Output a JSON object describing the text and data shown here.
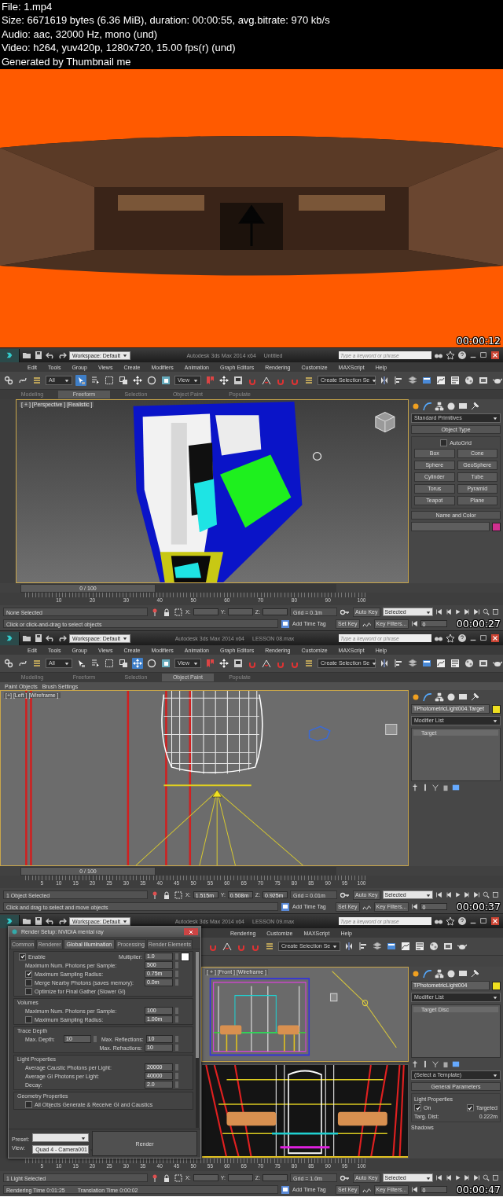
{
  "header": {
    "lines": [
      "File: 1.mp4",
      "Size: 6671619 bytes (6.36 MiB), duration: 00:00:55, avg.bitrate: 970 kb/s",
      "Audio: aac, 32000 Hz, mono (und)",
      "Video: h264, yuv420p, 1280x720, 15.00 fps(r) (und)",
      "Generated by Thumbnail me"
    ]
  },
  "frames": [
    {
      "kind": "video",
      "timestamp": "00:00:12"
    },
    {
      "kind": "max",
      "timestamp": "00:00:27",
      "workspace": "Workspace: Default",
      "app_title": "Autodesk 3ds Max 2014 x64",
      "file_name": "Untitled",
      "search_placeholder": "Type a keyword or phrase",
      "menu": [
        "Edit",
        "Tools",
        "Group",
        "Views",
        "Create",
        "Modifiers",
        "Animation",
        "Graph Editors",
        "Rendering",
        "Customize",
        "MAXScript",
        "Help"
      ],
      "toolbar": {
        "filter": "All",
        "coord": "View",
        "selection_set": "Create Selection Se",
        "select_active": true,
        "move_active": false
      },
      "ribbon_tabs": [
        {
          "label": "Modeling",
          "selected": false
        },
        {
          "label": "Freeform",
          "selected": true
        },
        {
          "label": "Selection",
          "selected": false
        },
        {
          "label": "Object Paint",
          "selected": false
        },
        {
          "label": "Populate",
          "selected": false
        }
      ],
      "viewports": [
        {
          "label": "[ + ] [Perspective ] [Realistic ]",
          "kind": "perspective"
        }
      ],
      "command_panel": {
        "kind": "create",
        "category": "Standard Primitives",
        "object_type": "Object Type",
        "autogrid": {
          "label": "AutoGrid",
          "checked": false
        },
        "buttons": [
          "Box",
          "Cone",
          "Sphere",
          "GeoSphere",
          "Cylinder",
          "Tube",
          "Torus",
          "Pyramid",
          "Teapot",
          "Plane"
        ],
        "name_color": "Name and Color"
      },
      "time_slider": {
        "label": "0 / 100",
        "level": 0
      },
      "ruler": [
        "10",
        "20",
        "30",
        "40",
        "50",
        "60",
        "70",
        "80",
        "90",
        "100"
      ],
      "status": {
        "selection": "None Selected",
        "coords": [
          {
            "label": "X:"
          },
          {
            "label": "Y:"
          },
          {
            "label": "Z:"
          }
        ],
        "grid": "Grid = 0.1m",
        "auto_key": "Auto Key",
        "key_mode": "Selected",
        "set_key": "Set Key",
        "key_filters": "Key Filters...",
        "prompts": [
          "Click or click-and-drag to select objects"
        ],
        "time_tag": "Add Time Tag",
        "frame": "0"
      }
    },
    {
      "kind": "max",
      "timestamp": "00:00:37",
      "workspace": "Workspace: Default",
      "app_title": "Autodesk 3ds Max 2014 x64",
      "file_name": "LESSON 08.max",
      "search_placeholder": "Type a keyword or phrase",
      "menu": [
        "Edit",
        "Tools",
        "Group",
        "Views",
        "Create",
        "Modifiers",
        "Animation",
        "Graph Editors",
        "Rendering",
        "Customize",
        "MAXScript",
        "Help"
      ],
      "toolbar": {
        "filter": "All",
        "coord": "View",
        "selection_set": "Create Selection Se",
        "select_active": false,
        "move_active": true
      },
      "ribbon_tabs": [
        {
          "label": "Modeling",
          "selected": false
        },
        {
          "label": "Freeform",
          "selected": false
        },
        {
          "label": "Selection",
          "selected": false
        },
        {
          "label": "Object Paint",
          "selected": true
        },
        {
          "label": "Populate",
          "selected": false
        }
      ],
      "ribbon_panel": [
        "Paint Objects",
        "Brush Settings"
      ],
      "viewports": [
        {
          "label": "[+] [Left ] [Wireframe ]",
          "kind": "left"
        }
      ],
      "command_panel": {
        "kind": "modify",
        "object_name": "TPhotometricLight004.Target",
        "modifier_list": "Modifier List",
        "stack": [
          "Target"
        ]
      },
      "time_slider": {
        "label": "0 / 100",
        "level": 0
      },
      "ruler": [
        "5",
        "10",
        "15",
        "20",
        "25",
        "30",
        "35",
        "40",
        "45",
        "50",
        "55",
        "60",
        "65",
        "70",
        "75",
        "80",
        "85",
        "90",
        "95",
        "100"
      ],
      "status": {
        "selection": "1 Object Selected",
        "coords": [
          {
            "label": "X:",
            "value": "1.515m"
          },
          {
            "label": "Y:",
            "value": "0.508m"
          },
          {
            "label": "Z:",
            "value": "0.925m"
          }
        ],
        "grid": "Grid = 0.01m",
        "auto_key": "Auto Key",
        "key_mode": "Selected",
        "set_key": "Set Key",
        "key_filters": "Key Filters...",
        "prompts": [
          "Click and drag to select and move objects"
        ],
        "time_tag": "Add Time Tag",
        "frame": "0"
      }
    },
    {
      "kind": "max",
      "timestamp": "00:00:47",
      "workspace": "Workspace: Default",
      "app_title": "Autodesk 3ds Max 2014 x64",
      "file_name": "LESSON 09.max",
      "search_placeholder": "Type a keyword or phrase",
      "menu": [
        "Rendering",
        "Customize",
        "MAXScript",
        "Help"
      ],
      "toolbar": {
        "selection_set": "Create Selection Se"
      },
      "viewports": [
        {
          "label": "[ + ] [Front ] [Wireframe ]",
          "kind": "front"
        },
        {
          "kind": "camera"
        }
      ],
      "command_panel": {
        "kind": "modify",
        "object_name": "TPhotometricLight004",
        "modifier_list": "Modifier List",
        "stack": [
          "Target Disc"
        ],
        "template": "(Select a Template)",
        "general": "General Parameters",
        "light_props": "Light Properties",
        "on": {
          "label": "On",
          "checked": true
        },
        "targeted": {
          "label": "Targeted",
          "checked": true
        },
        "targ_dist_label": "Targ. Dist:",
        "targ_dist": "0.222m",
        "shadows": "Shadows"
      },
      "ruler": [
        "5",
        "10",
        "15",
        "20",
        "25",
        "30",
        "35",
        "40",
        "45",
        "50",
        "55",
        "60",
        "65",
        "70",
        "75",
        "80",
        "85",
        "90",
        "95",
        "100"
      ],
      "status": {
        "selection": "1 Light Selected",
        "coords": [
          {
            "label": "X:"
          },
          {
            "label": "Y:"
          },
          {
            "label": "Z:"
          }
        ],
        "grid": "Grid = 1.0m",
        "auto_key": "Auto Key",
        "key_mode": "Selected",
        "set_key": "Set Key",
        "key_filters": "Key Filters...",
        "prompts": [
          "Rendering Time  0:01:25",
          "Translation Time  0:00:02"
        ],
        "time_tag": "Add Time Tag",
        "frame": "0"
      },
      "dialog": {
        "title": "Render Setup: NVIDIA mental ray",
        "tabs": [
          {
            "label": "Common",
            "selected": false
          },
          {
            "label": "Renderer",
            "selected": false
          },
          {
            "label": "Global Illumination",
            "selected": true
          },
          {
            "label": "Processing",
            "selected": false
          },
          {
            "label": "Render Elements",
            "selected": false
          }
        ],
        "sections": [
          {
            "rows": [
              {
                "kind": "enable",
                "label": "Enable",
                "checked": true,
                "value_label": "Multiplier:",
                "value": "1.0"
              },
              {
                "kind": "value",
                "label": "Maximum Num. Photons per Sample:",
                "value": "500"
              },
              {
                "kind": "check",
                "label": "Maximum Sampling Radius:",
                "checked": true,
                "value": "0.75m"
              },
              {
                "kind": "check",
                "label": "Merge Nearby Photons (saves memory):",
                "checked": false,
                "value": "0.0m"
              },
              {
                "kind": "check",
                "label": "Optimize for Final Gather (Slower GI)",
                "checked": false
              }
            ]
          },
          {
            "title": "Volumes",
            "rows": [
              {
                "kind": "value",
                "label": "Maximum Num. Photons per Sample:",
                "value": "100"
              },
              {
                "kind": "check",
                "label": "Maximum Sampling Radius:",
                "checked": false,
                "value": "1.00m"
              }
            ]
          },
          {
            "title": "Trace Depth",
            "rows": [
              {
                "kind": "depth",
                "label": "Max. Depth:",
                "value": "10",
                "right_label": "Max. Reflections:",
                "right_value": "10"
              },
              {
                "kind": "depth",
                "right_label": "Max. Refractions:",
                "right_value": "10"
              }
            ]
          },
          {
            "title": "Light Properties",
            "rows": [
              {
                "kind": "value",
                "label": "Average Caustic Photons per Light:",
                "value": "20000"
              },
              {
                "kind": "value",
                "label": "Average GI Photons per Light:",
                "value": "40000"
              },
              {
                "kind": "value",
                "label": "Decay:",
                "value": "2.0"
              }
            ]
          },
          {
            "title": "Geometry Properties",
            "rows": [
              {
                "kind": "check",
                "label": "All Objects Generate & Receive GI and Caustics",
                "checked": false
              }
            ]
          }
        ],
        "preset_label": "Preset:",
        "view_label": "View:",
        "view": "Quad 4 - Camera001",
        "render": "Render"
      }
    }
  ]
}
